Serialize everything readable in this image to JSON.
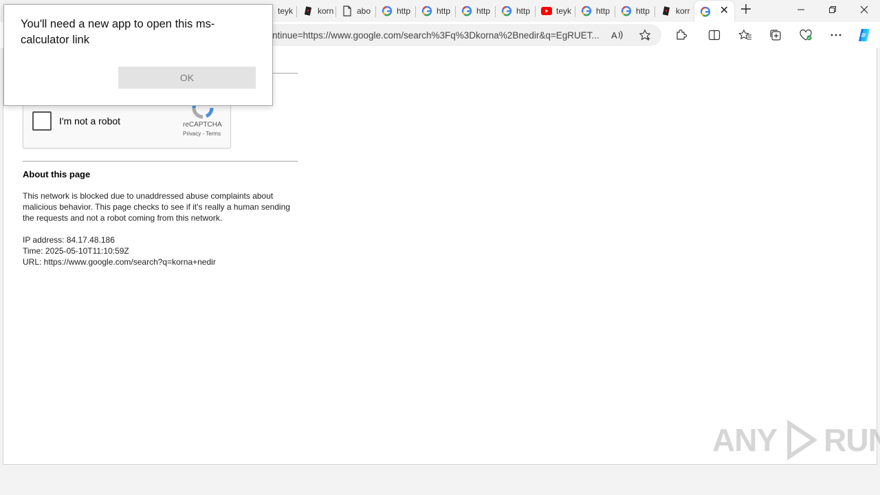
{
  "tabs": [
    {
      "label": "teyk",
      "favicon": "page-icon"
    },
    {
      "label": "korn",
      "favicon": "roblox-icon"
    },
    {
      "label": "abo",
      "favicon": "document-icon"
    },
    {
      "label": "http",
      "favicon": "google-icon"
    },
    {
      "label": "http",
      "favicon": "google-icon"
    },
    {
      "label": "http",
      "favicon": "google-icon"
    },
    {
      "label": "http",
      "favicon": "google-icon"
    },
    {
      "label": "teyk",
      "favicon": "youtube-icon"
    },
    {
      "label": "http",
      "favicon": "google-icon"
    },
    {
      "label": "http",
      "favicon": "google-icon"
    },
    {
      "label": "korr",
      "favicon": "roblox-icon"
    }
  ],
  "address_bar": {
    "url_text": "ntinue=https://www.google.com/search%3Fq%3Dkorna%2Bnedir&q=EgRUET..."
  },
  "recaptcha": {
    "label": "I'm not a robot",
    "brand": "reCAPTCHA",
    "links": "Privacy - Terms"
  },
  "about": {
    "title": "About this page",
    "body": "This network is blocked due to unaddressed abuse complaints about malicious behavior. This page checks to see if it's really a human sending the requests and not a robot coming from this network."
  },
  "info": {
    "ip": "IP address: 84.17.48.186",
    "time": "Time: 2025-05-10T11:10:59Z",
    "url": "URL: https://www.google.com/search?q=korna+nedir"
  },
  "dialog": {
    "message": "You'll need a new app to open this ms-calculator link",
    "ok_label": "OK"
  },
  "watermark": {
    "left": "ANY",
    "right": "RUN"
  },
  "colors": {
    "youtube_red": "#ff0000",
    "google_blue": "#4285f4",
    "copilot_accent": "#1a73e8"
  }
}
